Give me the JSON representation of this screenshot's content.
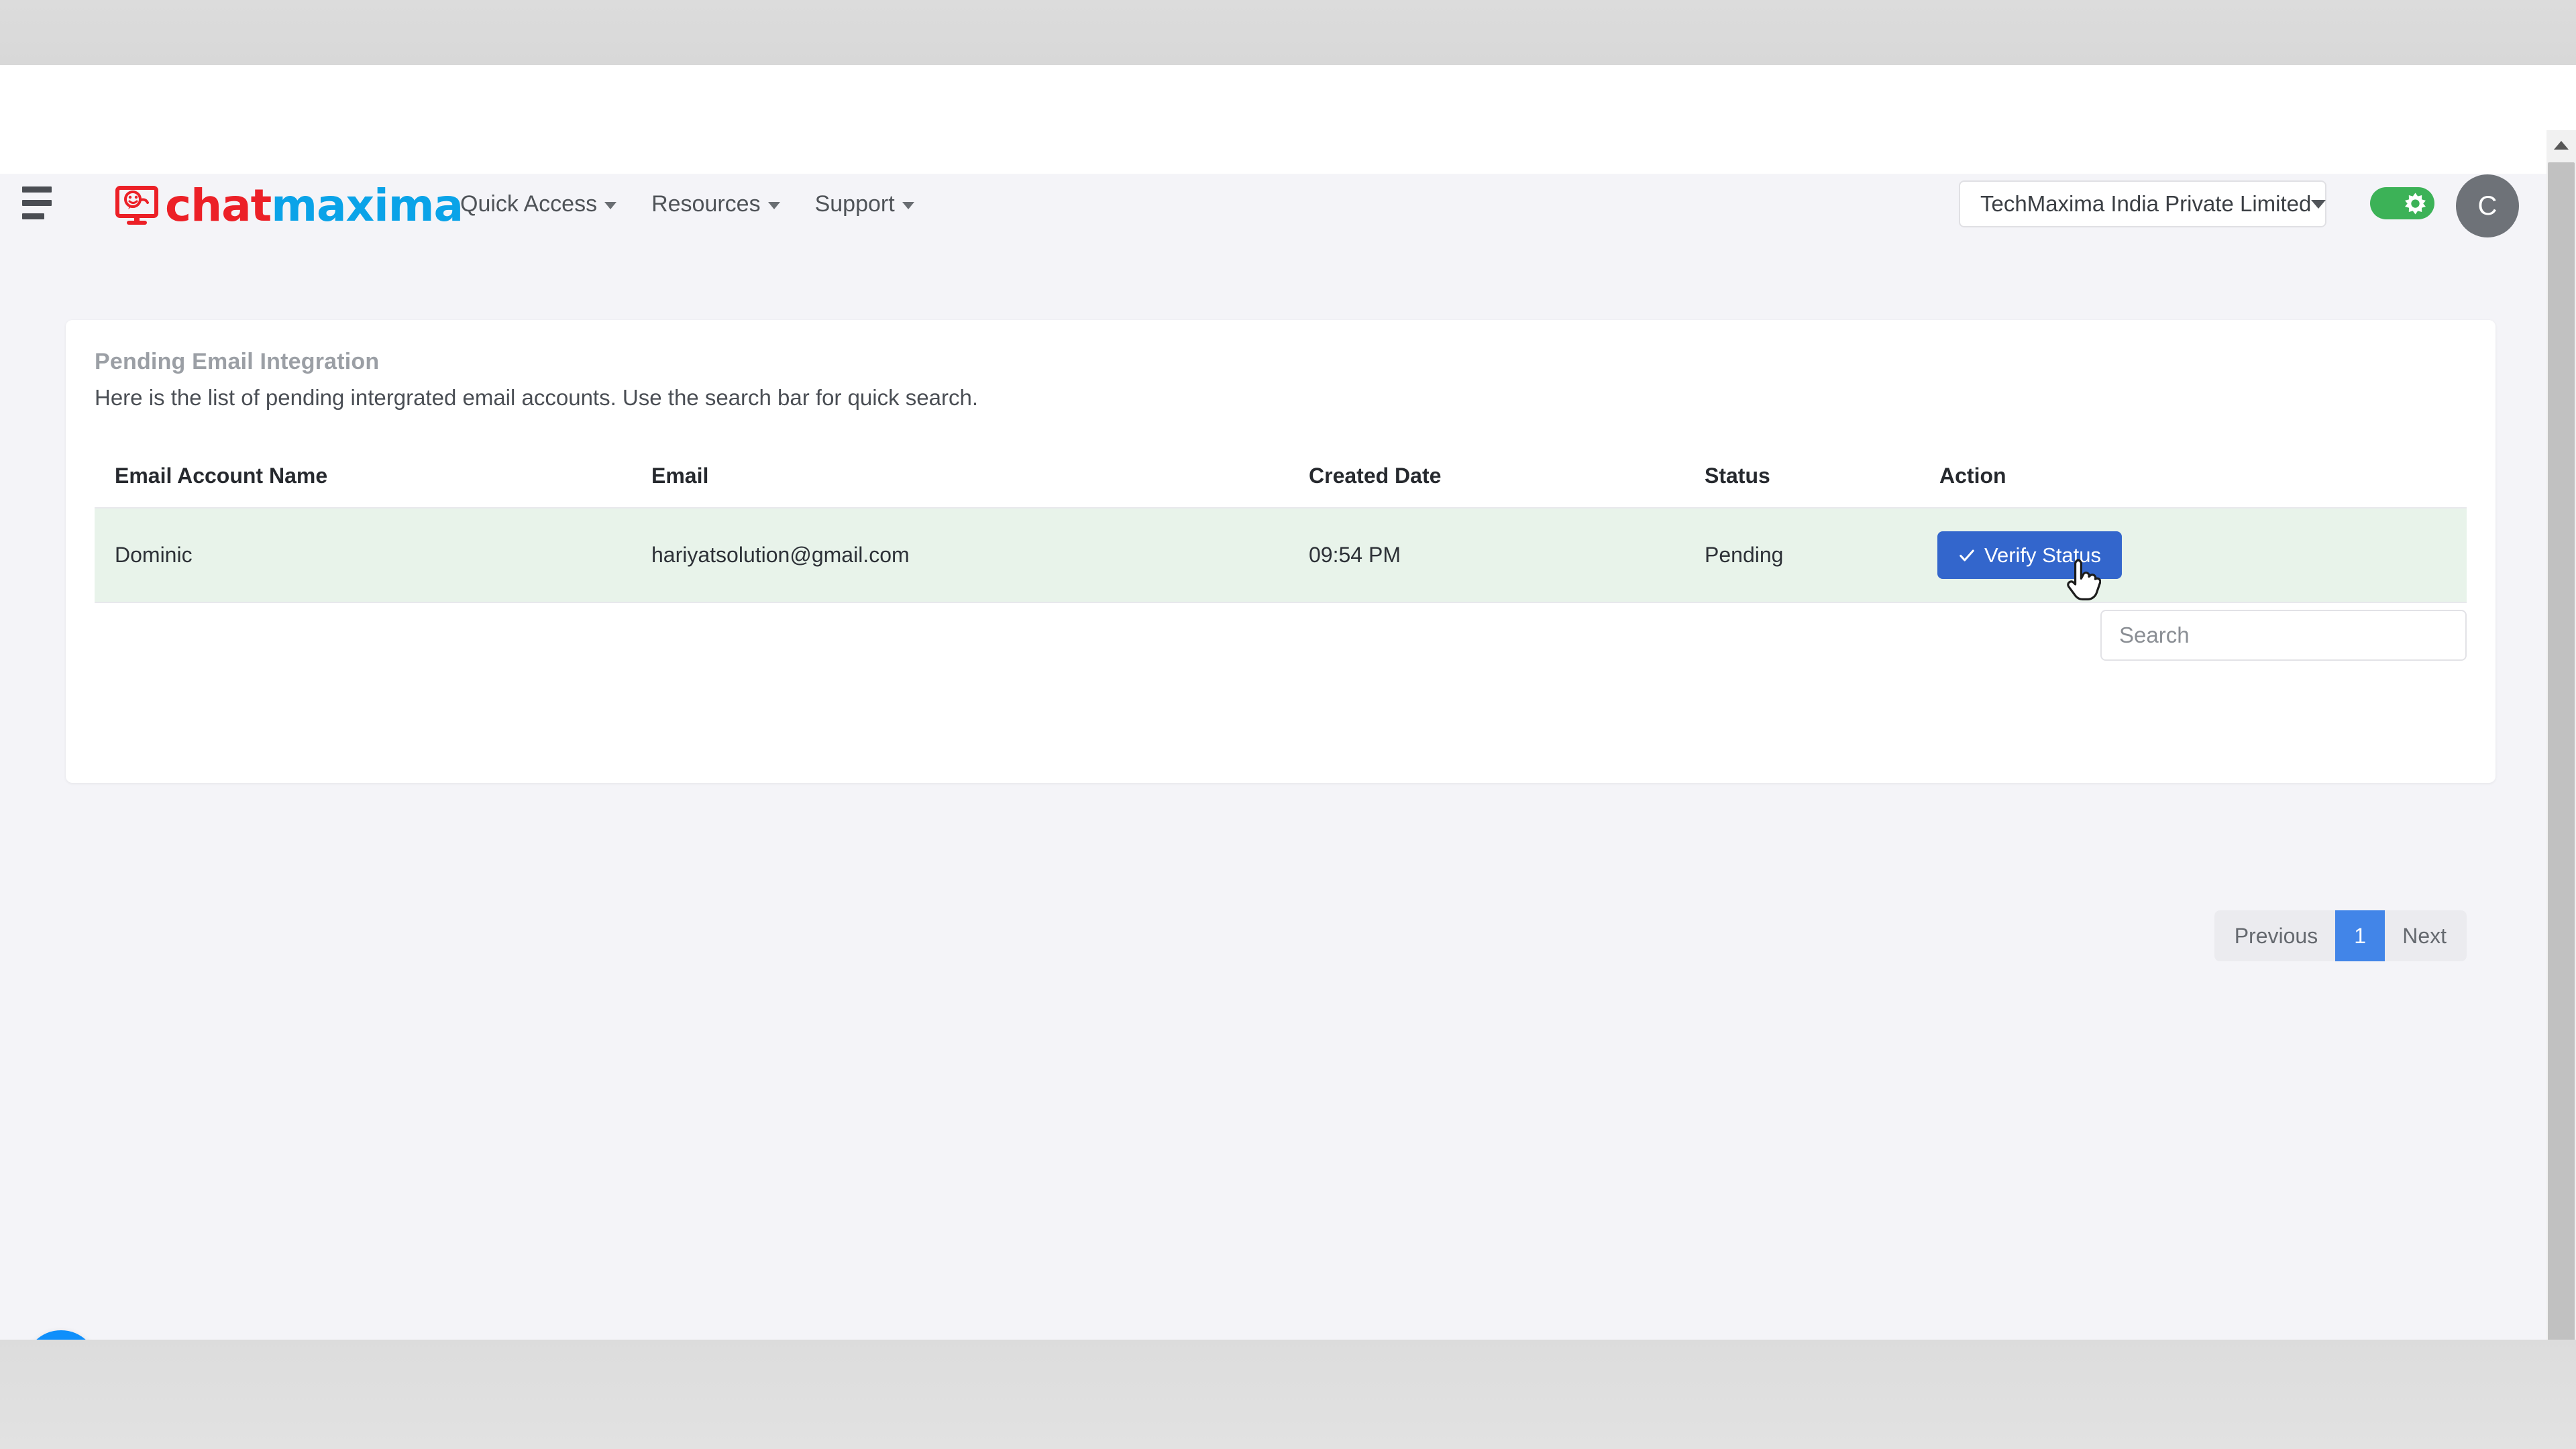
{
  "app": {
    "brand_name_part1": "chat",
    "brand_name_part2": "maxima",
    "brand_colors": {
      "red": "#ec2027",
      "blue": "#0aa3e8"
    }
  },
  "header": {
    "menu_icon": "hamburger-icon",
    "logo_icon": "chatmaxima-monitor-logo-icon",
    "nav_items": [
      {
        "label": "Quick Access",
        "icon": "chevron-down-icon"
      },
      {
        "label": "Resources",
        "icon": "chevron-down-icon"
      },
      {
        "label": "Support",
        "icon": "chevron-down-icon"
      }
    ],
    "org_selector": {
      "value": "TechMaxima India Private Limited",
      "icon": "chevron-down-icon"
    },
    "theme_toggle": {
      "state": "on",
      "icon": "sun-icon",
      "color": "#3cb257"
    },
    "avatar": {
      "initial": "C",
      "color": "#6e7278"
    }
  },
  "card": {
    "title": "Pending Email Integration",
    "description": "Here is the list of pending intergrated email accounts. Use the search bar for quick search.",
    "search": {
      "placeholder": "Search",
      "value": ""
    }
  },
  "table": {
    "columns": [
      "Email Account Name",
      "Email",
      "Created Date",
      "Status",
      "Action"
    ],
    "rows": [
      {
        "account_name": "Dominic",
        "email": "hariyatsolution@gmail.com",
        "created_date": "09:54 PM",
        "status": "Pending",
        "action_label": "Verify Status",
        "action_icon": "check-icon",
        "action_color": "#3366cc",
        "row_color": "#e8f3ea"
      }
    ]
  },
  "pagination": {
    "previous_label": "Previous",
    "next_label": "Next",
    "current_page": "1",
    "active_color": "#4285e8"
  },
  "chat_widget": {
    "icon": "chat-bubbles-icon",
    "color": "#0e8ffb"
  },
  "scrollbar": {
    "up_icon": "scroll-up-arrow-icon",
    "down_icon": "scroll-down-arrow-icon"
  },
  "cursor": {
    "icon": "pointer-hand-cursor-icon"
  }
}
